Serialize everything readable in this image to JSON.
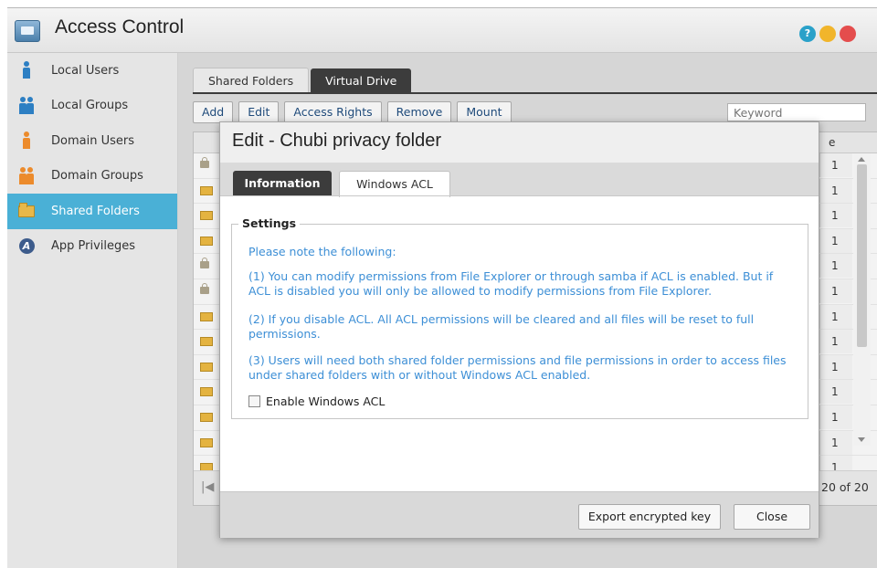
{
  "app": {
    "title": "Access Control"
  },
  "window_buttons": {
    "help": "?",
    "minimize": "",
    "close": ""
  },
  "sidebar": {
    "items": [
      {
        "label": "Local Users",
        "icon": "user-icon"
      },
      {
        "label": "Local Groups",
        "icon": "group-icon"
      },
      {
        "label": "Domain Users",
        "icon": "domain-user-icon"
      },
      {
        "label": "Domain Groups",
        "icon": "domain-group-icon"
      },
      {
        "label": "Shared Folders",
        "icon": "folder-icon",
        "active": true
      },
      {
        "label": "App Privileges",
        "icon": "app-privileges-icon"
      }
    ]
  },
  "main": {
    "tabs": [
      {
        "label": "Shared Folders",
        "active": false
      },
      {
        "label": "Virtual Drive",
        "active": true
      }
    ],
    "toolbar": {
      "add": "Add",
      "edit": "Edit",
      "access_rights": "Access Rights",
      "remove": "Remove",
      "mount": "Mount"
    },
    "search": {
      "placeholder": "Keyword"
    },
    "grid": {
      "partial_header": "e",
      "rows": [
        {
          "icon": "lock-icon",
          "value": "1"
        },
        {
          "icon": "folder-icon",
          "value": "1"
        },
        {
          "icon": "folder-icon",
          "value": "1"
        },
        {
          "icon": "folder-icon",
          "value": "1"
        },
        {
          "icon": "lock-icon",
          "value": "1"
        },
        {
          "icon": "lock-icon",
          "value": "1"
        },
        {
          "icon": "folder-icon",
          "value": "1"
        },
        {
          "icon": "folder-icon",
          "value": "1"
        },
        {
          "icon": "folder-icon",
          "value": "1"
        },
        {
          "icon": "folder-icon",
          "value": "1"
        },
        {
          "icon": "folder-icon",
          "value": "1"
        },
        {
          "icon": "folder-icon",
          "value": "1"
        },
        {
          "icon": "folder-icon",
          "value": "1"
        }
      ],
      "pager": {
        "first": "|◀",
        "count": "20 of 20"
      }
    }
  },
  "dialog": {
    "title": "Edit - Chubi privacy folder",
    "tabs": {
      "information": "Information",
      "windows_acl": "Windows ACL"
    },
    "settings": {
      "legend": "Settings",
      "note": "Please note the following:",
      "point1": "(1) You can modify permissions from File Explorer or through samba if ACL is enabled. But if ACL is disabled you will only be allowed to modify permissions from File Explorer.",
      "point2": "(2) If you disable ACL. All ACL permissions will be cleared and all files will be reset to full permissions.",
      "point3": "(3) Users will need both shared folder permissions and file permissions in order to access files under shared folders with or without Windows ACL enabled.",
      "checkbox_label": "Enable Windows ACL",
      "checkbox_checked": false
    },
    "buttons": {
      "export": "Export encrypted key",
      "close": "Close"
    }
  }
}
